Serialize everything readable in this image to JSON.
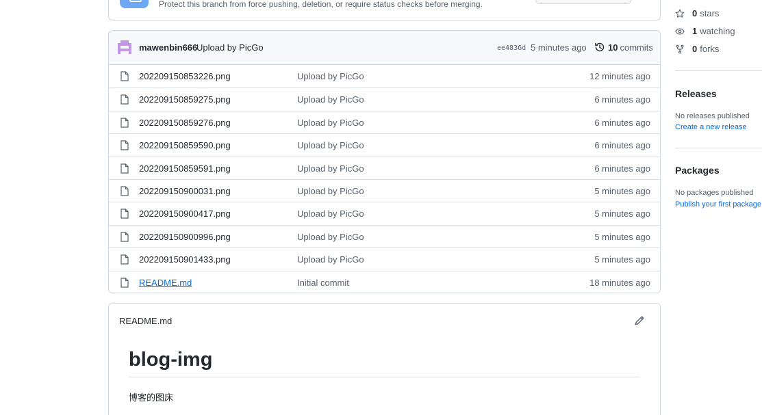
{
  "protection": {
    "text": "Protect this branch from force pushing, deletion, or require status checks before merging."
  },
  "latest_commit": {
    "author": "mawenbin666",
    "message": "Upload by PicGo",
    "sha": "ee4836d",
    "age": "5 minutes ago",
    "commits_count": "10",
    "commits_label": "commits"
  },
  "files": [
    {
      "name": "202209150853226.png",
      "message": "Upload by PicGo",
      "age": "12 minutes ago"
    },
    {
      "name": "202209150859275.png",
      "message": "Upload by PicGo",
      "age": "6 minutes ago"
    },
    {
      "name": "202209150859276.png",
      "message": "Upload by PicGo",
      "age": "6 minutes ago"
    },
    {
      "name": "202209150859590.png",
      "message": "Upload by PicGo",
      "age": "6 minutes ago"
    },
    {
      "name": "202209150859591.png",
      "message": "Upload by PicGo",
      "age": "6 minutes ago"
    },
    {
      "name": "202209150900031.png",
      "message": "Upload by PicGo",
      "age": "5 minutes ago"
    },
    {
      "name": "202209150900417.png",
      "message": "Upload by PicGo",
      "age": "5 minutes ago"
    },
    {
      "name": "202209150900996.png",
      "message": "Upload by PicGo",
      "age": "5 minutes ago"
    },
    {
      "name": "202209150901433.png",
      "message": "Upload by PicGo",
      "age": "5 minutes ago"
    },
    {
      "name": "README.md",
      "message": "Initial commit",
      "age": "18 minutes ago"
    }
  ],
  "readme": {
    "filename": "README.md",
    "heading": "blog-img",
    "body": "博客的图床"
  },
  "sidebar": {
    "stars_count": "0",
    "stars_label": "stars",
    "watching_count": "1",
    "watching_label": "watching",
    "forks_count": "0",
    "forks_label": "forks",
    "releases_title": "Releases",
    "releases_note": "No releases published",
    "releases_link": "Create a new release",
    "packages_title": "Packages",
    "packages_note": "No packages published",
    "packages_link": "Publish your first package"
  },
  "colors": {
    "link": "#0969da",
    "avatar": "#c297e6",
    "banner_icon": "#6ea8f5"
  }
}
